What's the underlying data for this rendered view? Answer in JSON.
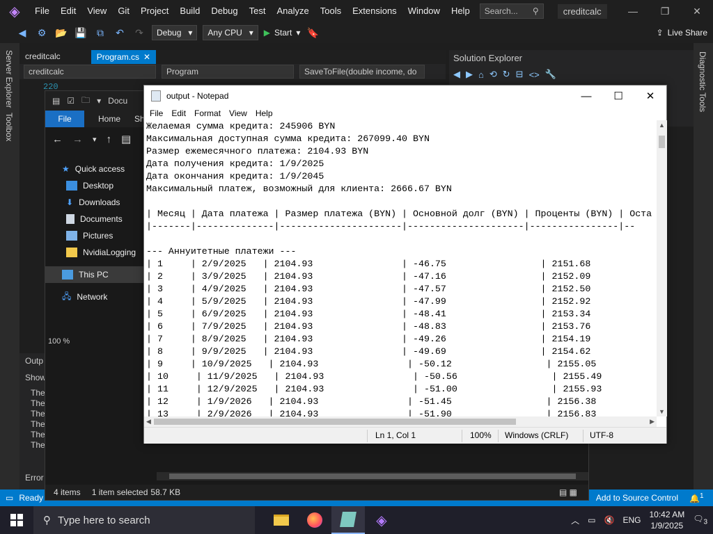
{
  "vs": {
    "menus": [
      "File",
      "Edit",
      "View",
      "Git",
      "Project",
      "Build",
      "Debug",
      "Test",
      "Analyze",
      "Tools",
      "Extensions",
      "Window",
      "Help"
    ],
    "search_placeholder": "Search...",
    "solution_name": "creditcalc",
    "toolbar": {
      "config": "Debug",
      "platform": "Any CPU",
      "start": "Start",
      "live_share": "Live Share"
    },
    "left_rail": [
      "Server Explorer",
      "Toolbox"
    ],
    "right_rail": "Diagnostic Tools",
    "tabs": [
      {
        "label": "creditcalc"
      },
      {
        "label": "Program.cs"
      }
    ],
    "nav": {
      "project": "creditcalc",
      "class": "Program",
      "method": "SaveToFile(double income, do"
    },
    "line_number": "220",
    "solution_explorer_title": "Solution Explorer",
    "bottom_panel": {
      "title": "Outp",
      "show": "Show",
      "lines": [
        "The",
        "The",
        "The",
        "The",
        "The",
        "The"
      ],
      "error_tab": "Error"
    },
    "status": {
      "ready": "Ready",
      "source_control": "Add to Source Control",
      "notifications": "1"
    }
  },
  "explorer": {
    "title": "Docu",
    "ribbon": [
      "File",
      "Home",
      "Sh"
    ],
    "nav_items": [
      {
        "label": "Quick access",
        "icon": "star-icon"
      },
      {
        "label": "Desktop",
        "icon": "desktop-icon"
      },
      {
        "label": "Downloads",
        "icon": "download-icon"
      },
      {
        "label": "Documents",
        "icon": "document-icon"
      },
      {
        "label": "Pictures",
        "icon": "pictures-icon"
      },
      {
        "label": "NvidiaLogging",
        "icon": "folder-icon"
      },
      {
        "label": "This PC",
        "icon": "pc-icon"
      },
      {
        "label": "Network",
        "icon": "network-icon"
      }
    ],
    "zoom": "100 %",
    "status": {
      "items": "4 items",
      "selected": "1 item selected",
      "size": "58.7 KB"
    }
  },
  "notepad": {
    "title": "output - Notepad",
    "menus": [
      "File",
      "Edit",
      "Format",
      "View",
      "Help"
    ],
    "lines": [
      "Желаемая сумма кредита: 245906 BYN",
      "Максимальная доступная сумма кредита: 267099.40 BYN",
      "Размер ежемесячного платежа: 2104.93 BYN",
      "Дата получения кредита: 1/9/2025",
      "Дата окончания кредита: 1/9/2045",
      "Максимальный платеж, возможный для клиента: 2666.67 BYN",
      "",
      "| Месяц | Дата платежа | Размер платежа (BYN) | Основной долг (BYN) | Проценты (BYN) | Оста",
      "|-------|--------------|----------------------|---------------------|----------------|--",
      "",
      "--- Аннуитетные платежи ---",
      "| 1     | 2/9/2025   | 2104.93                | -46.75                 | 2151.68",
      "| 2     | 3/9/2025   | 2104.93                | -47.16                 | 2152.09",
      "| 3     | 4/9/2025   | 2104.93                | -47.57                 | 2152.50",
      "| 4     | 5/9/2025   | 2104.93                | -47.99                 | 2152.92",
      "| 5     | 6/9/2025   | 2104.93                | -48.41                 | 2153.34",
      "| 6     | 7/9/2025   | 2104.93                | -48.83                 | 2153.76",
      "| 7     | 8/9/2025   | 2104.93                | -49.26                 | 2154.19",
      "| 8     | 9/9/2025   | 2104.93                | -49.69                 | 2154.62",
      "| 9     | 10/9/2025   | 2104.93                | -50.12                 | 2155.05",
      "| 10     | 11/9/2025   | 2104.93                | -50.56                 | 2155.49",
      "| 11     | 12/9/2025   | 2104.93                | -51.00                 | 2155.93",
      "| 12     | 1/9/2026   | 2104.93                | -51.45                 | 2156.38",
      "| 13     | 2/9/2026   | 2104.93                | -51.90                 | 2156.83"
    ],
    "status": {
      "position": "Ln 1, Col 1",
      "zoom": "100%",
      "line_endings": "Windows (CRLF)",
      "encoding": "UTF-8"
    }
  },
  "taskbar": {
    "search_placeholder": "Type here to search",
    "language": "ENG",
    "time": "10:42 AM",
    "date": "1/9/2025",
    "notification_count": "3"
  },
  "colors": {
    "vs_accent": "#007acc",
    "vs_bg": "#1e1e1e",
    "explorer_file_tab": "#1a6fc4"
  }
}
